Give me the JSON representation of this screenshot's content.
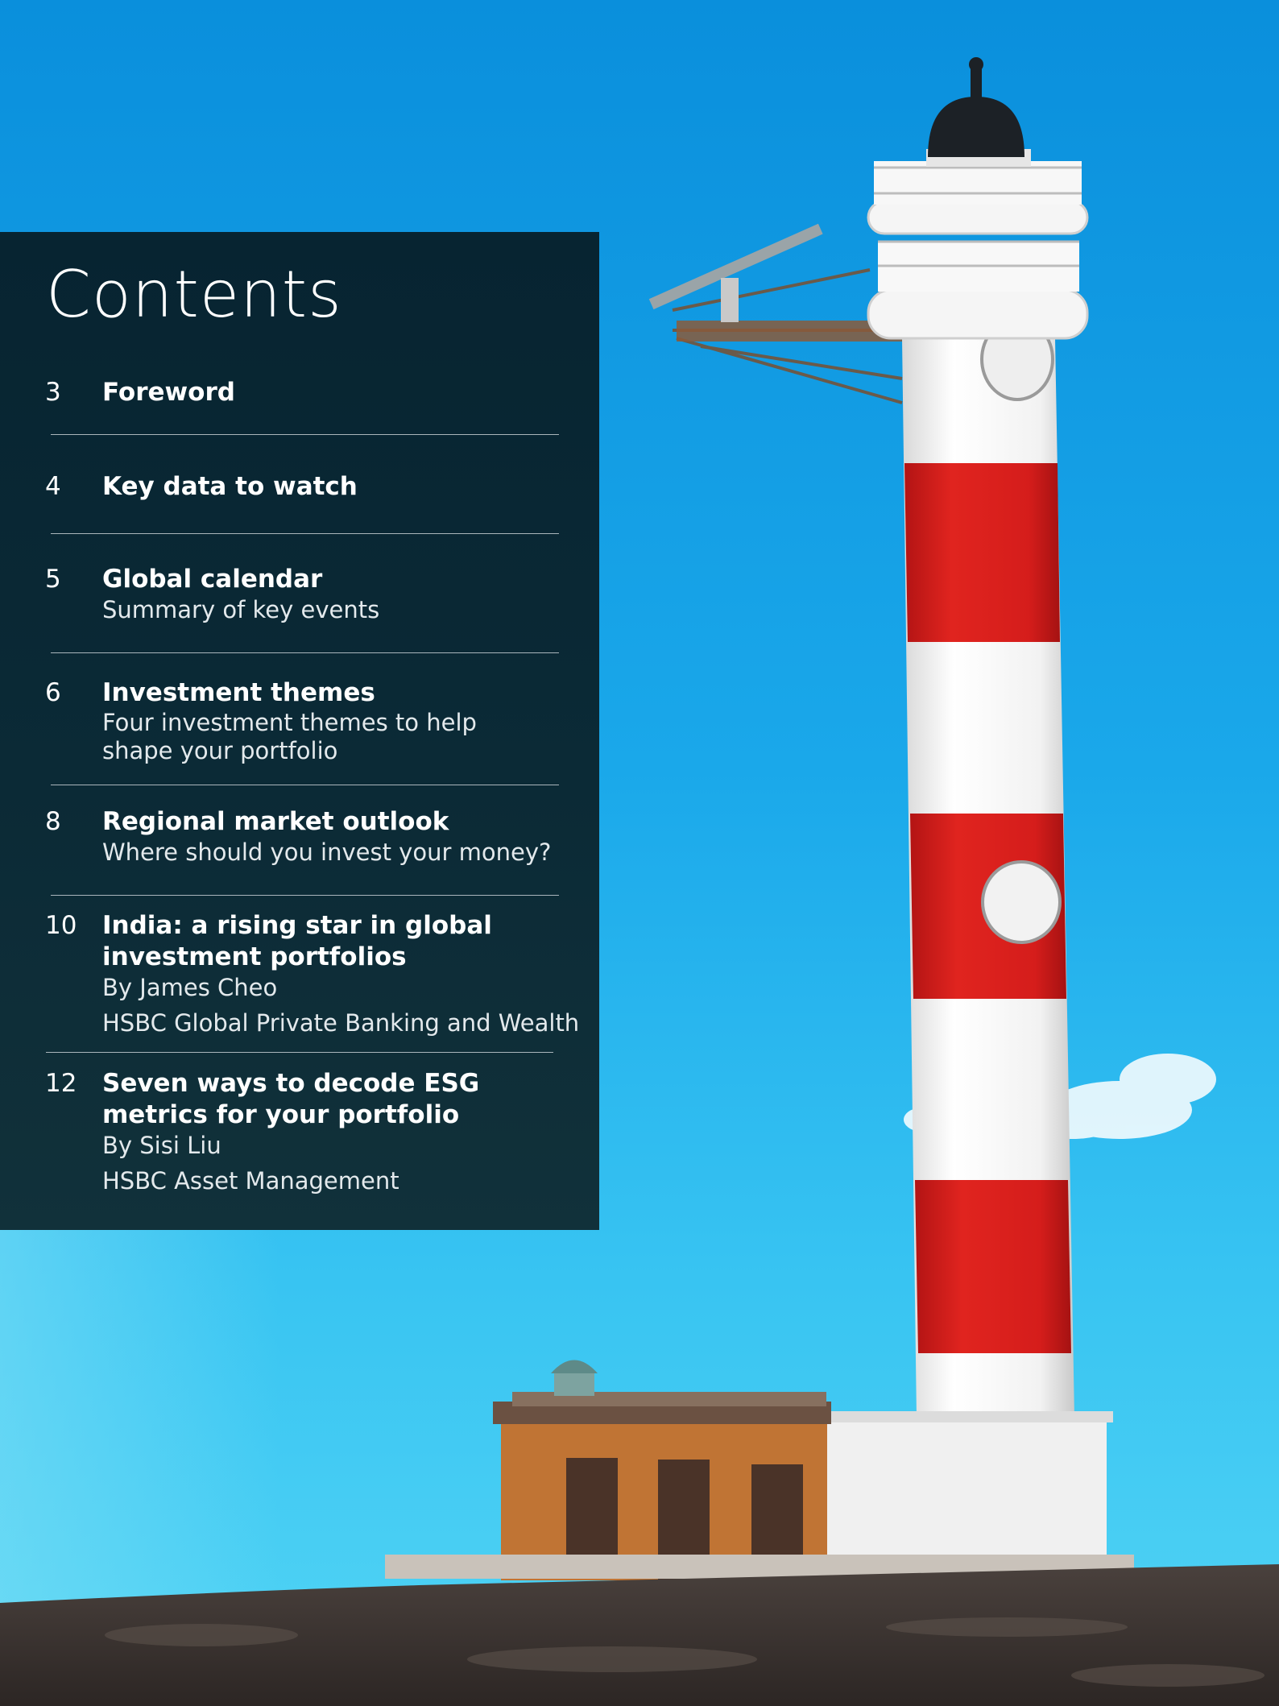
{
  "contents": {
    "title": "Contents",
    "entries": [
      {
        "page": "3",
        "title": "Foreword",
        "lines": []
      },
      {
        "page": "4",
        "title": "Key data to watch",
        "lines": []
      },
      {
        "page": "5",
        "title": "Global calendar",
        "lines": [
          "Summary of key events"
        ]
      },
      {
        "page": "6",
        "title": "Investment themes",
        "lines": [
          "Four investment themes to help",
          "shape your portfolio"
        ]
      },
      {
        "page": "8",
        "title": "Regional market outlook",
        "lines": [
          "Where should you invest your money?"
        ]
      },
      {
        "page": "10",
        "title": "India: a rising star in global investment portfolios",
        "lines": [
          "By James Cheo",
          "HSBC Global Private Banking and Wealth"
        ]
      },
      {
        "page": "12",
        "title": "Seven ways to decode ESG metrics for your portfolio",
        "lines": [
          "By Sisi Liu",
          "HSBC Asset Management"
        ]
      }
    ]
  },
  "photo": {
    "subject": "red-and-white-lighthouse",
    "colors": {
      "sky": "#1ea6e6",
      "stripe_red": "#d6201f",
      "stripe_white": "#f4f4f4",
      "ground": "#3d3532"
    }
  }
}
